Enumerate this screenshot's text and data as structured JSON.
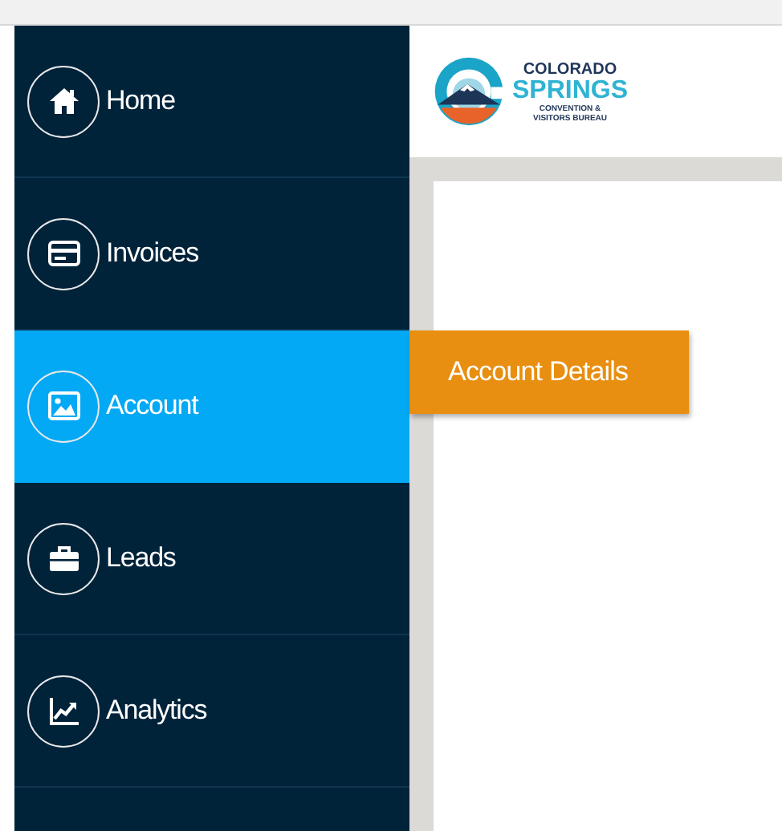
{
  "sidebar": {
    "items": [
      {
        "label": "Home",
        "selected": false
      },
      {
        "label": "Invoices",
        "selected": false
      },
      {
        "label": "Account",
        "selected": true
      },
      {
        "label": "Leads",
        "selected": false
      },
      {
        "label": "Analytics",
        "selected": false
      }
    ]
  },
  "logo": {
    "line_1": "COLORADO",
    "line_2": "SPRINGS",
    "line_3": "CONVENTION &",
    "line_4": "VISITORS BUREAU"
  },
  "flyout": {
    "items": [
      {
        "label": "Account Details"
      }
    ]
  }
}
